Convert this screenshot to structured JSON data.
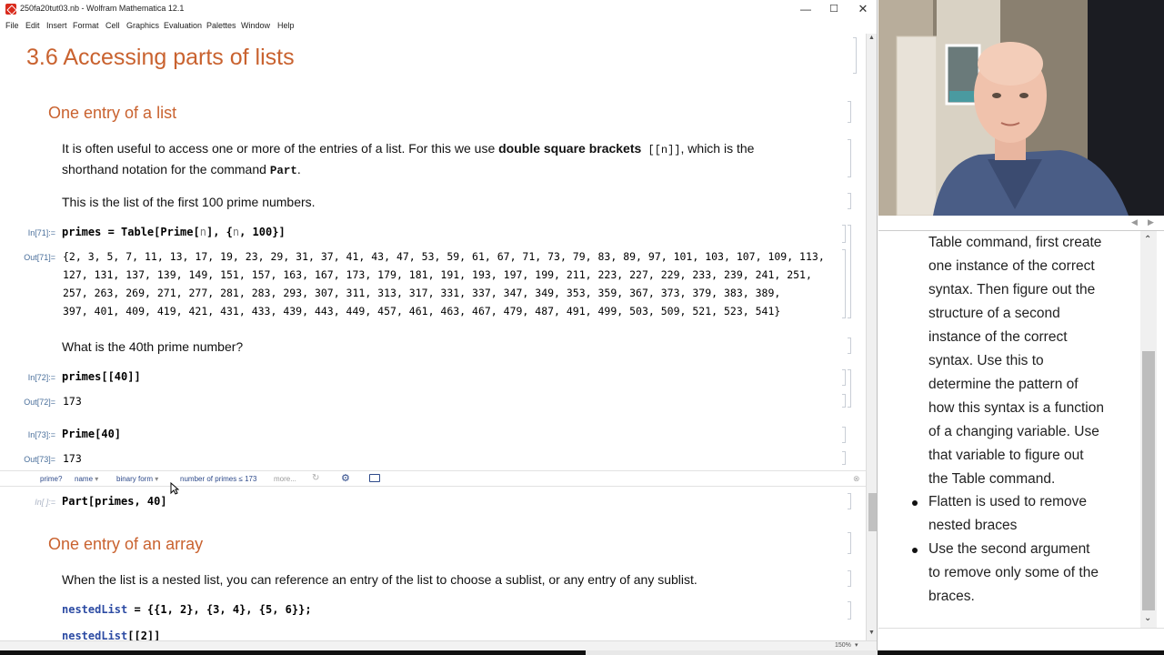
{
  "window": {
    "title": "250fa20tut03.nb - Wolfram Mathematica 12.1",
    "minimize": "—",
    "maximize": "☐",
    "close": "✕"
  },
  "menu": [
    "File",
    "Edit",
    "Insert",
    "Format",
    "Cell",
    "Graphics",
    "Evaluation",
    "Palettes",
    "Window",
    "Help"
  ],
  "notebook": {
    "title": "3.6 Accessing parts of lists",
    "section1": "One entry of a list",
    "p1_a": "It is often useful to access one or more of the entries of a list.  For this we use ",
    "p1_bold": "double square brackets",
    "p1_code": " [[n]]",
    "p1_b": ", which is the",
    "p1_c": "shorthand notation for the command ",
    "p1_cmd": "Part",
    "p1_end": ".",
    "p2": "This is the list of the first 100 prime numbers.",
    "in71_label": "In[71]:=",
    "in71_a": "primes",
    "in71_b": " = Table[Prime[",
    "in71_c": "n",
    "in71_d": "], {",
    "in71_e": "n",
    "in71_f": ", 100}]",
    "out71_label": "Out[71]=",
    "out71_lines": [
      "{2, 3, 5, 7, 11, 13, 17, 19, 23, 29, 31, 37, 41, 43, 47, 53, 59, 61, 67, 71, 73, 79, 83, 89, 97, 101, 103, 107, 109, 113,",
      " 127, 131, 137, 139, 149, 151, 157, 163, 167, 173, 179, 181, 191, 193, 197, 199, 211, 223, 227, 229, 233, 239, 241, 251,",
      " 257, 263, 269, 271, 277, 281, 283, 293, 307, 311, 313, 317, 331, 337, 347, 349, 353, 359, 367, 373, 379, 383, 389,",
      " 397, 401, 409, 419, 421, 431, 433, 439, 443, 449, 457, 461, 463, 467, 479, 487, 491, 499, 503, 509, 521, 523, 541}"
    ],
    "p3": "What is the 40th prime number?",
    "in72_label": "In[72]:=",
    "in72": "primes[[40]]",
    "out72_label": "Out[72]=",
    "out72": "173",
    "in73_label": "In[73]:=",
    "in73": "Prime[40]",
    "out73_label": "Out[73]=",
    "out73": "173",
    "suggestions": [
      "prime?",
      "name",
      "binary form",
      "number of primes ≤ 173",
      "more..."
    ],
    "in_blank_label": "In[ ]:=",
    "in_part": "Part[primes, 40]",
    "section2": "One entry of an array",
    "p4": "When the list is a nested list, you can reference an entry of the list to choose a sublist, or any entry of any sublist.",
    "nested_a": "nestedList",
    "nested_b": " = {{1, 2}, {3, 4}, {5, 6}};",
    "nested2_a": "nestedList",
    "nested2_b": "[[2]]",
    "zoom": "150%"
  },
  "notes": {
    "lines": [
      "Table command, first create",
      "one instance of the correct",
      "syntax. Then figure out the",
      "structure of a second",
      "instance of the correct",
      "syntax. Use this to",
      "determine the pattern of",
      "how this syntax is a function",
      "of a changing variable. Use",
      "that variable to figure out",
      "the Table command."
    ],
    "bullet1": [
      "Flatten is used to remove",
      "nested braces"
    ],
    "bullet2": [
      "Use the second argument",
      "to remove only some of the",
      "braces."
    ]
  }
}
